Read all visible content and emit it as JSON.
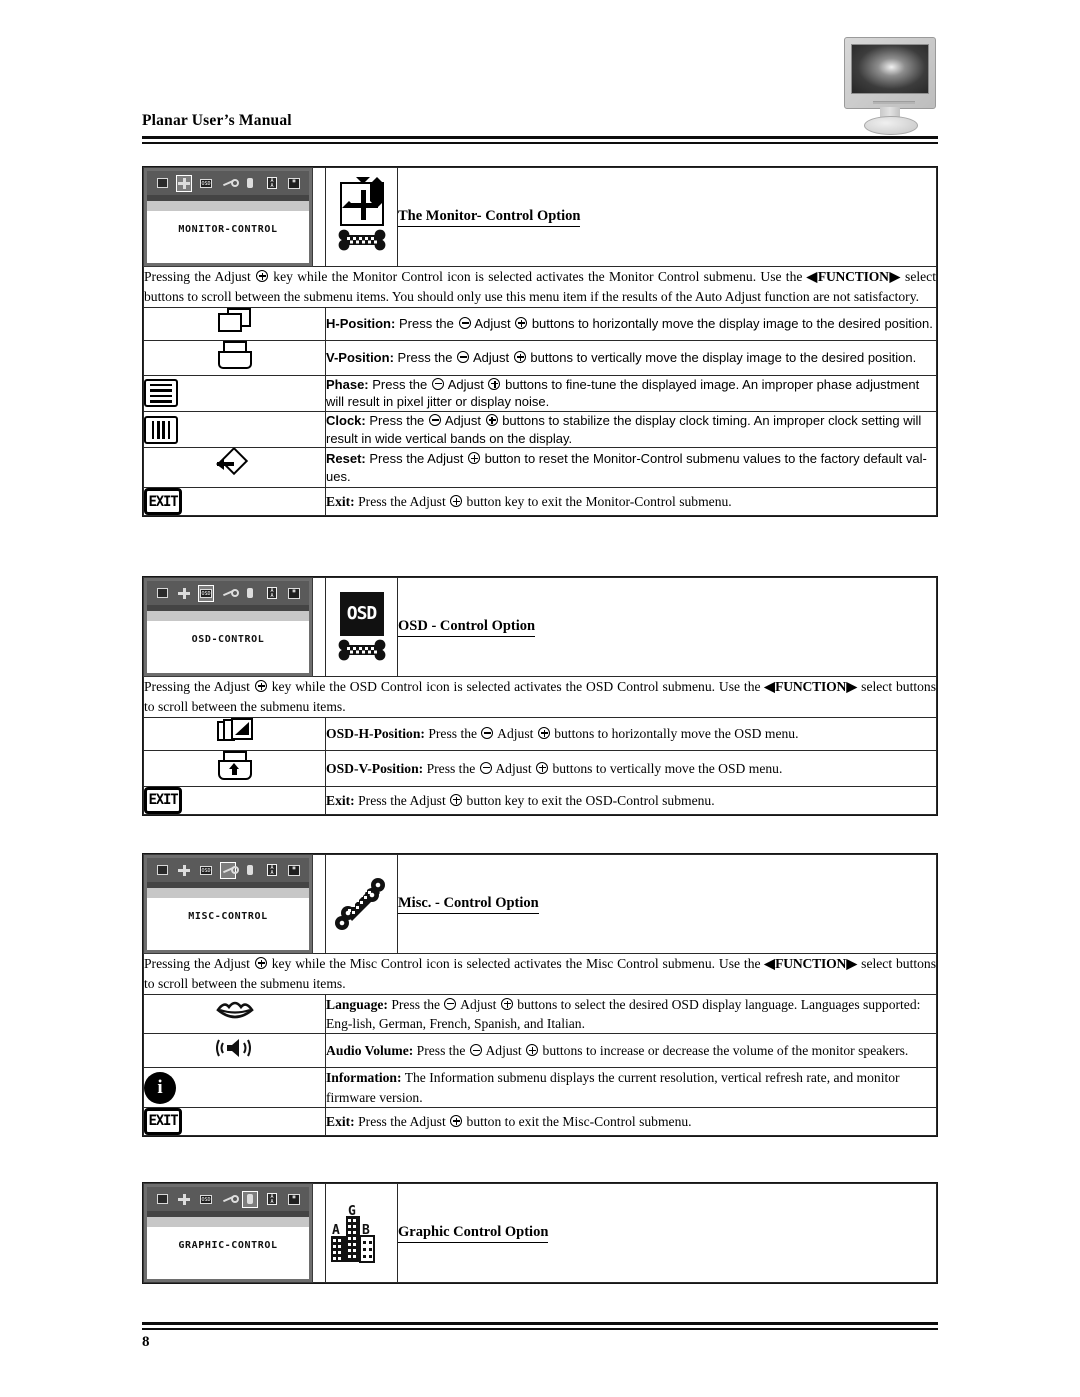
{
  "header": {
    "title": "Planar User’s Manual",
    "monitor_icon": "lcd-monitor-illustration"
  },
  "footer": {
    "page_number": "8"
  },
  "osd_menu_icons": [
    "monitor-icon",
    "position-icon",
    "osd-icon",
    "wrench-icon",
    "audio-icon",
    "language-icon",
    "graphic-icon"
  ],
  "sections": [
    {
      "id": "monitor-control",
      "osd_window_label": "MONITOR-CONTROL",
      "selected_index": 1,
      "glyph_primary": "four-way-move-arrows-icon",
      "glyph_secondary": "checkered-bone-icon",
      "title": "The Monitor- Control Option",
      "intro": "Pressing the Adjust ⊕ key while the Monitor Control icon is selected activates the Monitor Control submenu.  Use the ◀FUNCTION▶ select buttons to scroll between the submenu items.  You should only use this menu item if the results of the Auto Adjust function are not satisfactory.",
      "intro_parts": {
        "p1": "Pressing the Adjust",
        "p2": "key while the Monitor Control icon is selected activates the Monitor Control submenu.   Use the",
        "fn": "◀FUNCTION▶",
        "p3": "select buttons to scroll between the submenu items.  You should only use this menu item if the results of the Auto Adjust function are not satisfactory."
      },
      "rows": [
        {
          "icon": "h-position-icon",
          "label": "H-Position",
          "sep": ":",
          "t1": "Press the",
          "t2": "Adjust",
          "t3": "buttons to horizontally move the display image to the desired position.",
          "font": "sans"
        },
        {
          "icon": "v-position-icon",
          "label": "V-Position",
          "sep": ":",
          "t1": "Press the",
          "t2": "Adjust",
          "t3": "buttons to vertically move the display image to the desired position.",
          "font": "sans"
        },
        {
          "icon": "phase-icon",
          "label": "Phase:",
          "sep": "",
          "t1": "Press the",
          "t2": "Adjust",
          "t3": "buttons to fine-tune the displayed image.  An improper phase adjustment will result in pixel jitter or display noise.",
          "font": "sans"
        },
        {
          "icon": "clock-icon",
          "label": "Clock:",
          "sep": "",
          "t1": "Press the",
          "t2": "Adjust",
          "t3": "buttons to stabilize the display clock timing.  An improper clock setting will result in wide vertical bands on the display.",
          "font": "sans"
        },
        {
          "icon": "reset-icon",
          "label": "Reset:",
          "sep": "",
          "t1": " Press the Adjust",
          "t2": "",
          "t3": "button to reset the Monitor-Control submenu values to the factory default val-ues.",
          "font": "sans",
          "single_adjust": true
        },
        {
          "icon": "exit-icon",
          "label": "Exit:",
          "sep": "",
          "t1": " Press the Adjust",
          "t2": "",
          "t3": "button key to exit the Monitor-Control submenu.",
          "font": "serif",
          "single_adjust": true
        }
      ]
    },
    {
      "id": "osd-control",
      "osd_window_label": "OSD-CONTROL",
      "selected_index": 2,
      "glyph_primary": "osd-text-icon",
      "glyph_secondary": "checkered-bone-icon",
      "title": "OSD - Control Option",
      "intro_parts": {
        "p1": "Pressing the Adjust",
        "p2": "key while the OSD Control icon is selected activates the OSD Control submenu.   Use the",
        "fn": "◀FUNCTION▶",
        "p3": "select buttons to scroll between the submenu items."
      },
      "rows": [
        {
          "icon": "osd-h-position-icon",
          "label": "OSD-H-Position:",
          "sep": "",
          "t1": "Press the",
          "t2": "Adjust",
          "t3": "buttons to horizontally move the OSD menu.",
          "font": "serif"
        },
        {
          "icon": "osd-v-position-icon",
          "label": "OSD-V-Position:",
          "sep": "",
          "t1": "Press the",
          "t2": "Adjust",
          "t3": "buttons to vertically move the OSD menu.",
          "font": "serif"
        },
        {
          "icon": "exit-icon",
          "label": "Exit:",
          "sep": "",
          "t1": " Press the Adjust",
          "t2": "",
          "t3": "button key to exit the OSD-Control submenu.",
          "font": "serif",
          "single_adjust": true
        }
      ]
    },
    {
      "id": "misc-control",
      "osd_window_label": "MISC-CONTROL",
      "selected_index": 3,
      "glyph_primary": "wrench-icon",
      "glyph_secondary": "",
      "title": "Misc. - Control Option",
      "intro_parts": {
        "p1": "Pressing the Adjust",
        "p2": "key while the Misc Control icon is selected activates the Misc Control submenu.   Use the",
        "fn": "◀FUNCTION▶",
        "p3": "select buttons to scroll between the submenu items."
      },
      "rows": [
        {
          "icon": "language-lips-icon",
          "label": "Language:",
          "sep": "",
          "t1": "Press the",
          "t2": "Adjust",
          "t3": "buttons to select the desired OSD display language.  Languages supported:  Eng-lish, German, French, Spanish, and Italian.",
          "font": "serif"
        },
        {
          "icon": "audio-volume-icon",
          "label": "Audio Volume:",
          "sep": "",
          "t1": "Press the",
          "t2": "Adjust",
          "t3": "buttons to increase or decrease the volume of the monitor speakers.",
          "font": "serif"
        },
        {
          "icon": "information-icon",
          "label": "Information:",
          "sep": "",
          "t1": "",
          "t2": "",
          "t3": "The Information submenu displays the current resolution, vertical refresh rate, and monitor firmware version.",
          "font": "serif",
          "no_adjust": true
        },
        {
          "icon": "exit-icon",
          "label": "Exit:",
          "sep": "",
          "t1": " Press the Adjust",
          "t2": "",
          "t3": "button to exit the Misc-Control submenu.",
          "font": "serif",
          "single_adjust": true
        }
      ]
    },
    {
      "id": "graphic-control",
      "osd_window_label": "GRAPHIC-CONTROL",
      "selected_index": 6,
      "glyph_primary": "graphic-buildings-icon",
      "glyph_secondary": "",
      "title": "Graphic Control Option",
      "intro_parts": null,
      "rows": []
    }
  ]
}
